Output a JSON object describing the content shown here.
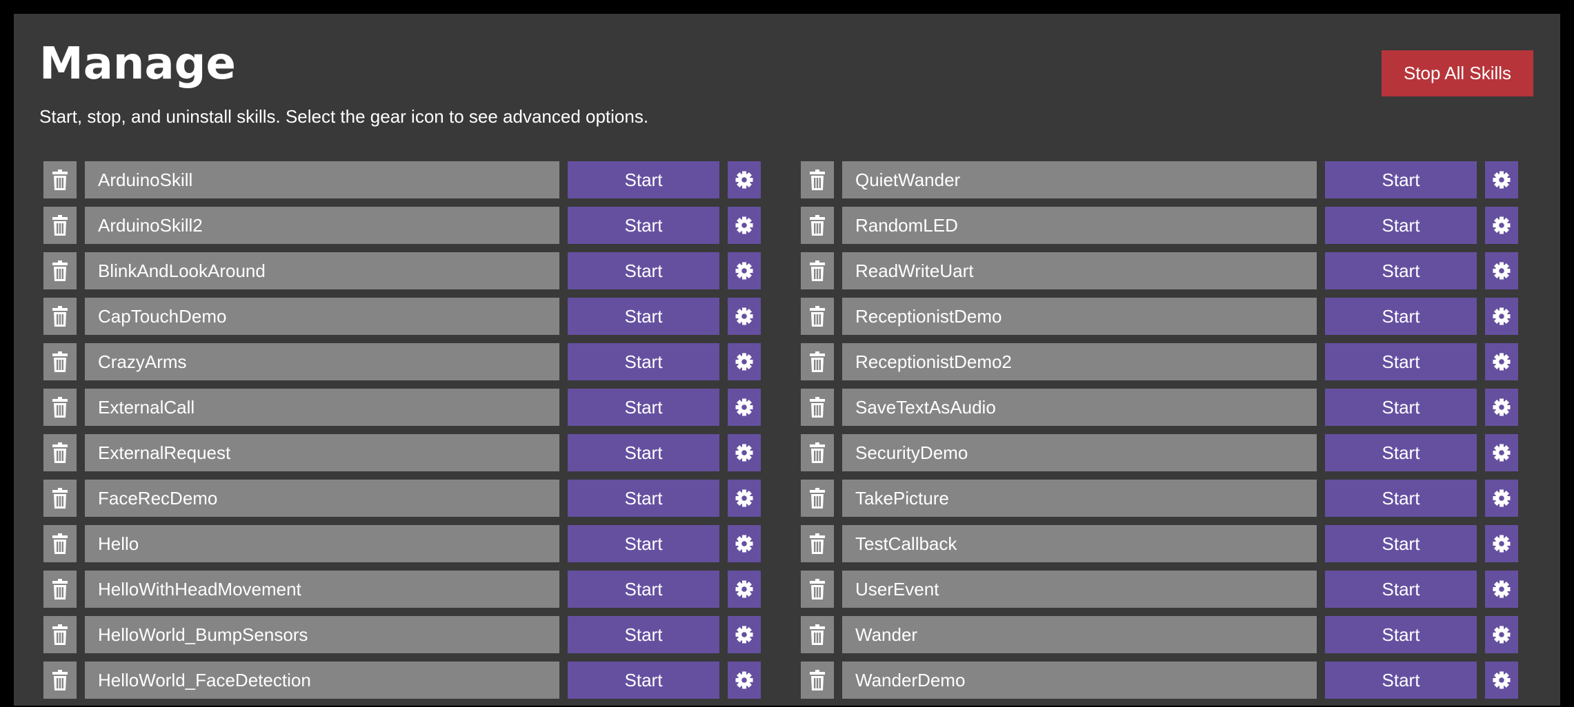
{
  "header": {
    "title": "Manage",
    "subtitle": "Start, stop, and uninstall skills. Select the gear icon to see advanced options.",
    "stop_all_label": "Stop All Skills"
  },
  "icons": {
    "delete": "trash-icon",
    "settings": "gear-icon"
  },
  "colors": {
    "background": "#393939",
    "row": "#858585",
    "accent": "#6550a0",
    "danger": "#b7353a"
  },
  "skills_left": [
    {
      "name": "ArduinoSkill",
      "action": "Start"
    },
    {
      "name": "ArduinoSkill2",
      "action": "Start"
    },
    {
      "name": "BlinkAndLookAround",
      "action": "Start"
    },
    {
      "name": "CapTouchDemo",
      "action": "Start"
    },
    {
      "name": "CrazyArms",
      "action": "Start"
    },
    {
      "name": "ExternalCall",
      "action": "Start"
    },
    {
      "name": "ExternalRequest",
      "action": "Start"
    },
    {
      "name": "FaceRecDemo",
      "action": "Start"
    },
    {
      "name": "Hello",
      "action": "Start"
    },
    {
      "name": "HelloWithHeadMovement",
      "action": "Start"
    },
    {
      "name": "HelloWorld_BumpSensors",
      "action": "Start"
    },
    {
      "name": "HelloWorld_FaceDetection",
      "action": "Start"
    }
  ],
  "skills_right": [
    {
      "name": "QuietWander",
      "action": "Start"
    },
    {
      "name": "RandomLED",
      "action": "Start"
    },
    {
      "name": "ReadWriteUart",
      "action": "Start"
    },
    {
      "name": "ReceptionistDemo",
      "action": "Start"
    },
    {
      "name": "ReceptionistDemo2",
      "action": "Start"
    },
    {
      "name": "SaveTextAsAudio",
      "action": "Start"
    },
    {
      "name": "SecurityDemo",
      "action": "Start"
    },
    {
      "name": "TakePicture",
      "action": "Start"
    },
    {
      "name": "TestCallback",
      "action": "Start"
    },
    {
      "name": "UserEvent",
      "action": "Start"
    },
    {
      "name": "Wander",
      "action": "Start"
    },
    {
      "name": "WanderDemo",
      "action": "Start"
    }
  ]
}
